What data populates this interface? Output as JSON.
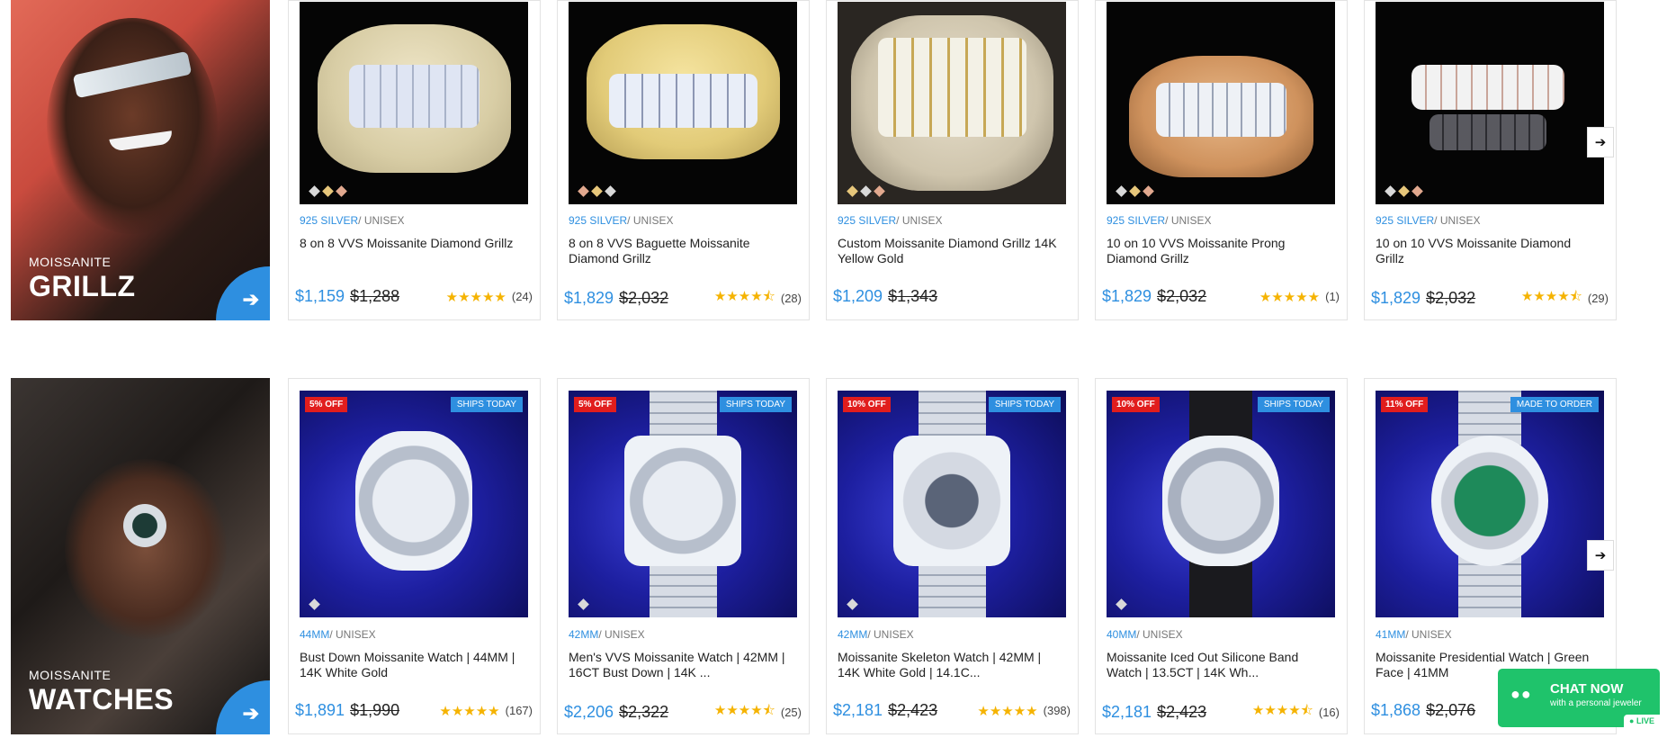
{
  "colors": {
    "accent": "#2e8fe0",
    "discount": "#e11d1d",
    "stars": "#f5b301",
    "chat": "#1fc36b"
  },
  "icons": {
    "hero_arrow": "arrow-right-icon",
    "carousel_next": "chevron-right-icon",
    "chat": "chat-bubble-icon",
    "star": "star-icon"
  },
  "sections": {
    "grillz": {
      "hero": {
        "kicker": "MOISSANITE",
        "title": "GRILLZ",
        "arrow": "➔"
      },
      "next": "➔",
      "products": [
        {
          "tag_a": "925 SILVER",
          "tag_b": "/ UNISEX",
          "name": "8 on 8 VVS Moissanite Diamond Grillz",
          "price": "$1,159",
          "was": "$1,288",
          "stars": "★★★★★",
          "rating": "(24)"
        },
        {
          "tag_a": "925 SILVER",
          "tag_b": "/ UNISEX",
          "name": "8 on 8 VVS Baguette Moissanite Diamond Grillz",
          "price": "$1,829",
          "was": "$2,032",
          "stars": "★★★★⯪",
          "rating": "(28)"
        },
        {
          "tag_a": "925 SILVER",
          "tag_b": "/ UNISEX",
          "name": "Custom Moissanite Diamond Grillz 14K Yellow Gold",
          "price": "$1,209",
          "was": "$1,343",
          "stars": "",
          "rating": ""
        },
        {
          "tag_a": "925 SILVER",
          "tag_b": "/ UNISEX",
          "name": "10 on 10 VVS Moissanite Prong Diamond Grillz",
          "price": "$1,829",
          "was": "$2,032",
          "stars": "★★★★★",
          "rating": "(1)"
        },
        {
          "tag_a": "925 SILVER",
          "tag_b": "/ UNISEX",
          "name": "10 on 10 VVS Moissanite Diamond Grillz",
          "price": "$1,829",
          "was": "$2,032",
          "stars": "★★★★⯪",
          "rating": "(29)"
        }
      ]
    },
    "watches": {
      "hero": {
        "kicker": "MOISSANITE",
        "title": "WATCHES",
        "arrow": "➔"
      },
      "next": "➔",
      "products": [
        {
          "off": "5% OFF",
          "ship": "SHIPS TODAY",
          "tag_a": "44MM",
          "tag_b": "/ UNISEX",
          "name": "Bust Down Moissanite Watch | 44MM | 14K White Gold",
          "price": "$1,891",
          "was": "$1,990",
          "stars": "★★★★★",
          "rating": "(167)"
        },
        {
          "off": "5% OFF",
          "ship": "SHIPS TODAY",
          "tag_a": "42MM",
          "tag_b": "/ UNISEX",
          "name": "Men's VVS Moissanite Watch | 42MM | 16CT Bust Down | 14K ...",
          "price": "$2,206",
          "was": "$2,322",
          "stars": "★★★★⯪",
          "rating": "(25)"
        },
        {
          "off": "10% OFF",
          "ship": "SHIPS TODAY",
          "tag_a": "42MM",
          "tag_b": "/ UNISEX",
          "name": "Moissanite Skeleton Watch | 42MM | 14K White Gold | 14.1C...",
          "price": "$2,181",
          "was": "$2,423",
          "stars": "★★★★★",
          "rating": "(398)"
        },
        {
          "off": "10% OFF",
          "ship": "SHIPS TODAY",
          "tag_a": "40MM",
          "tag_b": "/ UNISEX",
          "name": "Moissanite Iced Out Silicone Band Watch | 13.5CT | 14K Wh...",
          "price": "$2,181",
          "was": "$2,423",
          "stars": "★★★★⯪",
          "rating": "(16)"
        },
        {
          "off": "11% OFF",
          "ship": "MADE TO ORDER",
          "tag_a": "41MM",
          "tag_b": "/ UNISEX",
          "name": "Moissanite Presidential Watch | Green Face | 41MM",
          "price": "$1,868",
          "was": "$2,076",
          "stars": "",
          "rating": ""
        }
      ]
    }
  },
  "chat": {
    "icon": "●●",
    "title": "CHAT NOW",
    "subtitle": "with a personal jeweler",
    "live": "● LIVE"
  }
}
